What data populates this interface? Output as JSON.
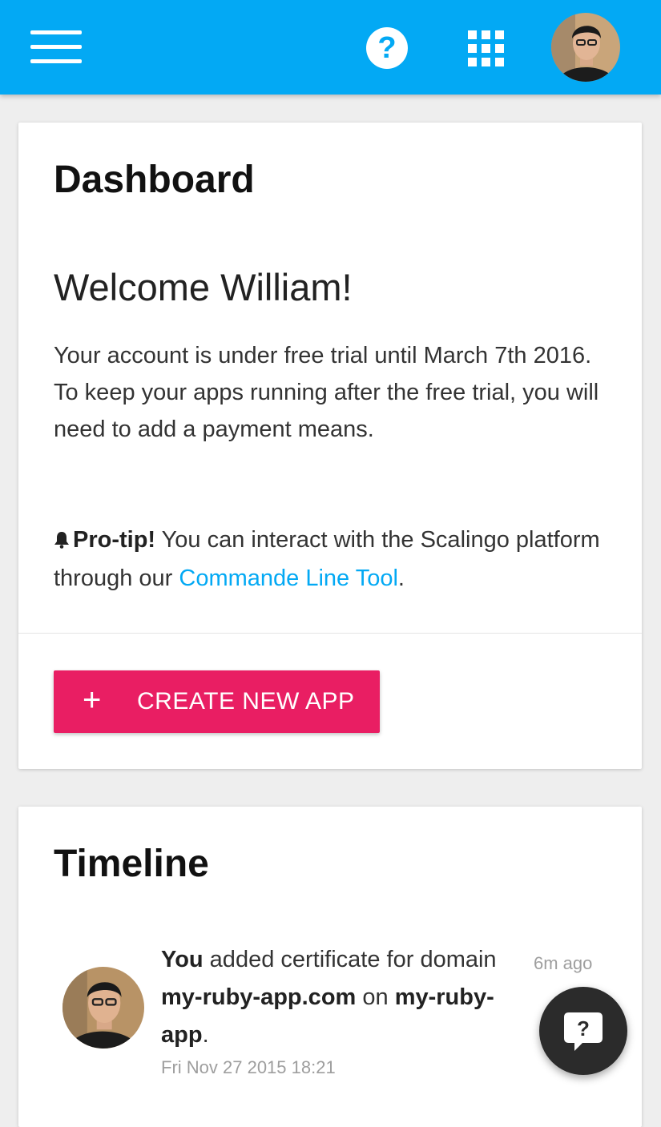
{
  "header": {
    "menu_icon": "hamburger-menu-icon",
    "help_icon": "question-circle-icon",
    "help_glyph": "?",
    "apps_icon": "grid-apps-icon",
    "accent_color": "#03a9f4"
  },
  "dashboard": {
    "title": "Dashboard",
    "welcome": "Welcome William!",
    "trial_text": "Your account is under free trial until March 7th 2016.",
    "payment_text": "To keep your apps running after the free trial, you will need to add a payment means.",
    "protip_label": "Pro-tip!",
    "protip_text": " You can interact with the Scalingo platform through our ",
    "protip_link": "Commande Line Tool",
    "protip_end": ".",
    "create_button_icon": "+",
    "create_button_label": "CREATE NEW APP",
    "button_color": "#e91e63"
  },
  "timeline": {
    "title": "Timeline",
    "entries": [
      {
        "actor": "You",
        "text_1": " added certificate for domain ",
        "domain": "my-ruby-app.com",
        "text_2": " on ",
        "app": "my-ruby-app",
        "text_3": ".",
        "date": "Fri Nov 27 2015 18:21",
        "ago": "6m ago"
      }
    ]
  },
  "chat": {
    "icon": "chat-help-icon",
    "glyph": "?"
  }
}
